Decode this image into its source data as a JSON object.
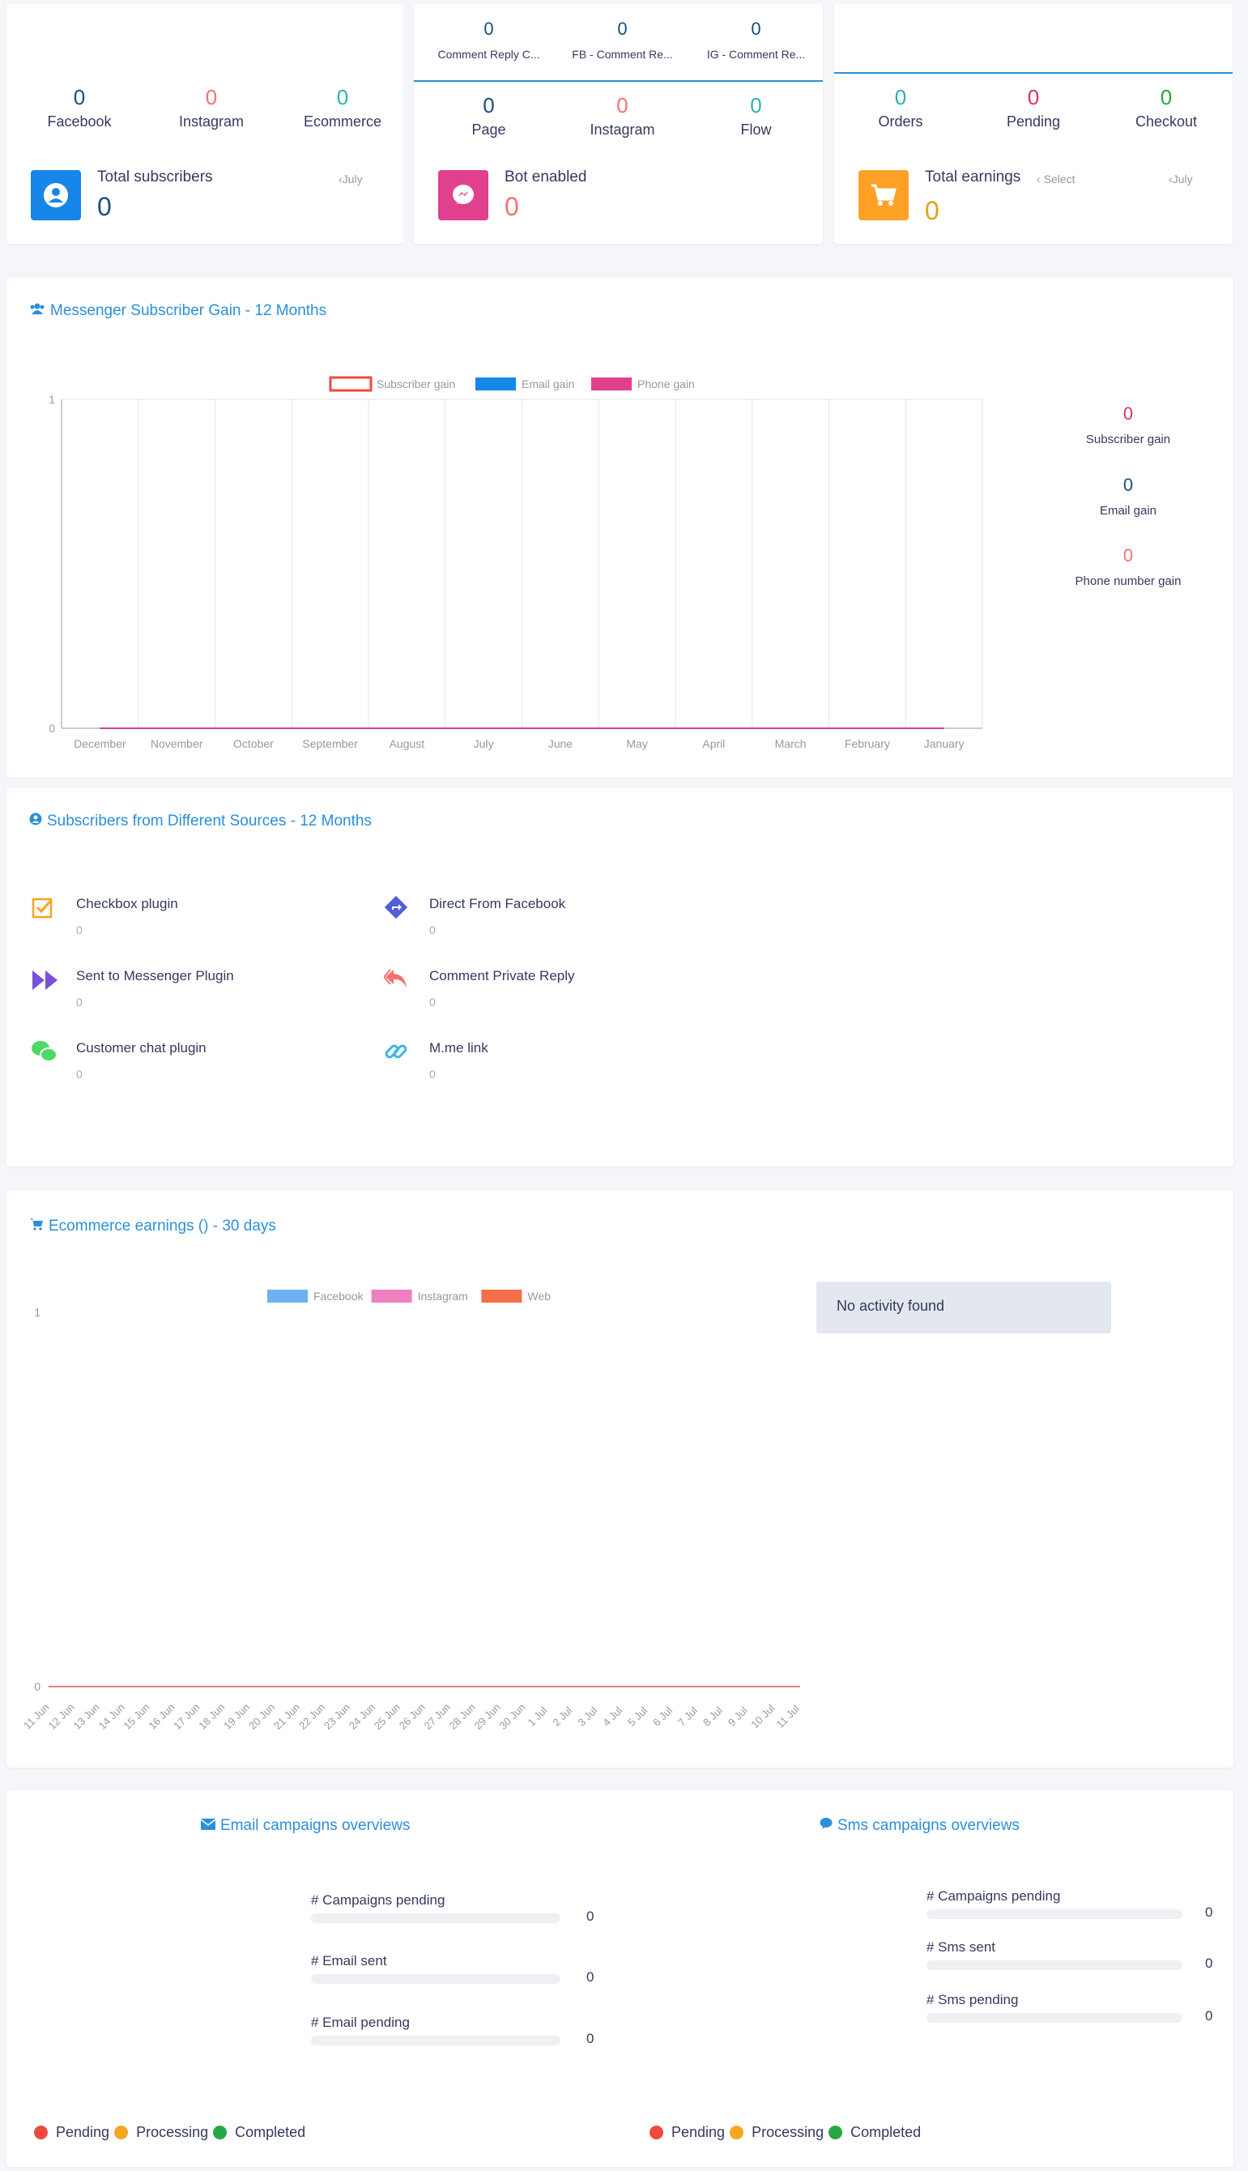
{
  "top_cards": [
    {
      "stats": [
        {
          "value": "0",
          "label": "Facebook",
          "color": "#1a4f7c"
        },
        {
          "value": "0",
          "label": "Instagram",
          "color": "#f37272"
        },
        {
          "value": "0",
          "label": "Ecommerce",
          "color": "#26b5b0"
        }
      ],
      "title": "Total subscribers",
      "value": "0",
      "month": "July",
      "icon": "user-circle-icon",
      "icon_color": "#1687e8"
    },
    {
      "tabs": [
        {
          "value": "0",
          "label": "Comment Reply C..."
        },
        {
          "value": "0",
          "label": "FB - Comment Re..."
        },
        {
          "value": "0",
          "label": "IG - Comment Re..."
        }
      ],
      "stats": [
        {
          "value": "0",
          "label": "Page",
          "color": "#1a4f7c"
        },
        {
          "value": "0",
          "label": "Instagram",
          "color": "#f37272"
        },
        {
          "value": "0",
          "label": "Flow",
          "color": "#26b5b0"
        }
      ],
      "title": "Bot enabled",
      "value": "0",
      "icon": "messenger-icon",
      "icon_color": "#e0408e"
    },
    {
      "stats": [
        {
          "value": "0",
          "label": "Orders",
          "color": "#26b5b0"
        },
        {
          "value": "0",
          "label": "Pending",
          "color": "#d6336c"
        },
        {
          "value": "0",
          "label": "Checkout",
          "color": "#28a745"
        }
      ],
      "title": "Total earnings",
      "select_label": "Select",
      "value": "0",
      "month": "July",
      "icon": "cart-icon",
      "icon_color": "#ffa126"
    }
  ],
  "subscriber_gain": {
    "title": "Messenger Subscriber Gain - 12 Months",
    "side_stats": [
      {
        "value": "0",
        "label": "Subscriber gain",
        "color": "#d6336c"
      },
      {
        "value": "0",
        "label": "Email gain",
        "color": "#1a4f7c"
      },
      {
        "value": "0",
        "label": "Phone number gain",
        "color": "#f37272"
      }
    ]
  },
  "sources": {
    "title": "Subscribers from Different Sources - 12 Months",
    "items": [
      {
        "label": "Checkbox plugin",
        "value": "0",
        "icon": "checkbox-icon"
      },
      {
        "label": "Direct From Facebook",
        "value": "0",
        "icon": "direction-icon"
      },
      {
        "label": "Sent to Messenger Plugin",
        "value": "0",
        "icon": "fast-forward-icon"
      },
      {
        "label": "Comment Private Reply",
        "value": "0",
        "icon": "reply-all-icon"
      },
      {
        "label": "Customer chat plugin",
        "value": "0",
        "icon": "chat-bubbles-icon"
      },
      {
        "label": "M.me link",
        "value": "0",
        "icon": "link-icon"
      }
    ]
  },
  "ecommerce": {
    "title": "Ecommerce earnings () - 30 days",
    "no_activity": "No activity found"
  },
  "email_campaigns": {
    "title": "Email campaigns overviews",
    "bars": [
      {
        "label": "# Campaigns pending",
        "value": "0",
        "fraction": 0
      },
      {
        "label": "# Email sent",
        "value": "0",
        "fraction": 0
      },
      {
        "label": "# Email pending",
        "value": "0",
        "fraction": 0
      }
    ],
    "legend": [
      "Pending",
      "Processing",
      "Completed"
    ]
  },
  "sms_campaigns": {
    "title": "Sms campaigns overviews",
    "bars": [
      {
        "label": "# Campaigns pending",
        "value": "0",
        "fraction": 0
      },
      {
        "label": "# Sms sent",
        "value": "0",
        "fraction": 0
      },
      {
        "label": "# Sms pending",
        "value": "0",
        "fraction": 0
      }
    ],
    "legend": [
      "Pending",
      "Processing",
      "Completed"
    ]
  },
  "legend_colors": {
    "pending": "#f0483e",
    "processing": "#f5a623",
    "completed": "#28a745"
  },
  "chart_data": [
    {
      "type": "line",
      "categories": [
        "December",
        "November",
        "October",
        "September",
        "August",
        "July",
        "June",
        "May",
        "April",
        "March",
        "February",
        "January"
      ],
      "series": [
        {
          "name": "Subscriber gain",
          "values": [
            0,
            0,
            0,
            0,
            0,
            0,
            0,
            0,
            0,
            0,
            0,
            0
          ],
          "color": "#f0483e"
        },
        {
          "name": "Email gain",
          "values": [
            0,
            0,
            0,
            0,
            0,
            0,
            0,
            0,
            0,
            0,
            0,
            0
          ],
          "color": "#1687e8"
        },
        {
          "name": "Phone gain",
          "values": [
            0,
            0,
            0,
            0,
            0,
            0,
            0,
            0,
            0,
            0,
            0,
            0
          ],
          "color": "#e0408e"
        }
      ],
      "ylim": [
        0,
        1
      ],
      "y_ticks": [
        "0",
        "1"
      ],
      "grid": true,
      "legend": "top-center"
    },
    {
      "type": "line",
      "categories": [
        "11 Jun",
        "12 Jun",
        "13 Jun",
        "14 Jun",
        "15 Jun",
        "16 Jun",
        "17 Jun",
        "18 Jun",
        "19 Jun",
        "20 Jun",
        "21 Jun",
        "22 Jun",
        "23 Jun",
        "24 Jun",
        "25 Jun",
        "26 Jun",
        "27 Jun",
        "28 Jun",
        "29 Jun",
        "30 Jun",
        "1 Jul",
        "2 Jul",
        "3 Jul",
        "4 Jul",
        "5 Jul",
        "6 Jul",
        "7 Jul",
        "8 Jul",
        "9 Jul",
        "10 Jul",
        "11 Jul"
      ],
      "series": [
        {
          "name": "Facebook",
          "values": [
            0,
            0,
            0,
            0,
            0,
            0,
            0,
            0,
            0,
            0,
            0,
            0,
            0,
            0,
            0,
            0,
            0,
            0,
            0,
            0,
            0,
            0,
            0,
            0,
            0,
            0,
            0,
            0,
            0,
            0,
            0
          ],
          "color": "#6cb2f0"
        },
        {
          "name": "Instagram",
          "values": [
            0,
            0,
            0,
            0,
            0,
            0,
            0,
            0,
            0,
            0,
            0,
            0,
            0,
            0,
            0,
            0,
            0,
            0,
            0,
            0,
            0,
            0,
            0,
            0,
            0,
            0,
            0,
            0,
            0,
            0,
            0
          ],
          "color": "#f07fbf"
        },
        {
          "name": "Web",
          "values": [
            0,
            0,
            0,
            0,
            0,
            0,
            0,
            0,
            0,
            0,
            0,
            0,
            0,
            0,
            0,
            0,
            0,
            0,
            0,
            0,
            0,
            0,
            0,
            0,
            0,
            0,
            0,
            0,
            0,
            0,
            0
          ],
          "color": "#f56e4a"
        }
      ],
      "ylim": [
        0,
        1
      ],
      "y_ticks": [
        "0",
        "1"
      ],
      "grid": false,
      "legend": "top-center"
    }
  ]
}
